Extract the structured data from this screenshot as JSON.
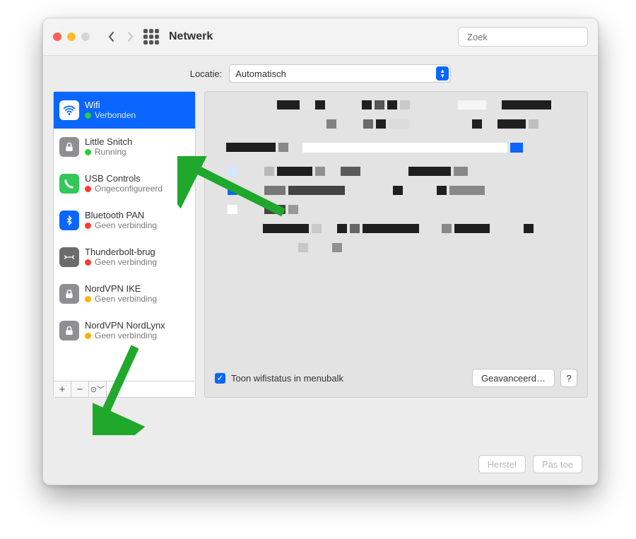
{
  "window": {
    "title": "Netwerk",
    "search_placeholder": "Zoek"
  },
  "location": {
    "label": "Locatie:",
    "value": "Automatisch"
  },
  "services": [
    {
      "name": "Wifi",
      "status": "Verbonden",
      "dot": "sd-green",
      "icon": "ic-wifi",
      "glyph": "wifi",
      "selected": true
    },
    {
      "name": "Little Snitch",
      "status": "Running",
      "dot": "sd-green",
      "icon": "ic-grey",
      "glyph": "lock"
    },
    {
      "name": "USB Controls",
      "status": "Ongeconfigureerd",
      "dot": "sd-red",
      "icon": "ic-green",
      "glyph": "phone"
    },
    {
      "name": "Bluetooth PAN",
      "status": "Geen verbinding",
      "dot": "sd-red",
      "icon": "ic-blue",
      "glyph": "bluetooth"
    },
    {
      "name": "Thunderbolt-brug",
      "status": "Geen verbinding",
      "dot": "sd-red",
      "icon": "ic-dark",
      "glyph": "bridge"
    },
    {
      "name": "NordVPN IKE",
      "status": "Geen verbinding",
      "dot": "sd-yellow",
      "icon": "ic-grey",
      "glyph": "lock"
    },
    {
      "name": "NordVPN NordLynx",
      "status": "Geen verbinding",
      "dot": "sd-yellow",
      "icon": "ic-grey",
      "glyph": "lock"
    }
  ],
  "sidebar_buttons": {
    "add": "+",
    "remove": "−",
    "action": "⊙﹀"
  },
  "panel": {
    "checkbox_label": "Toon wifistatus in menubalk",
    "advanced": "Geavanceerd…",
    "help": "?"
  },
  "footer": {
    "revert": "Herstel",
    "apply": "Pas toe"
  }
}
